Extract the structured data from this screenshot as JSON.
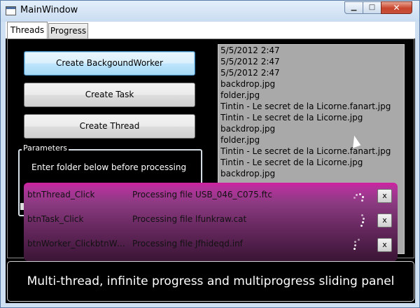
{
  "window": {
    "title": "MainWindow",
    "minimize_glyph": "▁",
    "maximize_glyph": "□",
    "close_glyph": "✕"
  },
  "tabs": [
    {
      "label": "Threads",
      "selected": true
    },
    {
      "label": "Progress",
      "selected": false
    }
  ],
  "buttons": {
    "worker": "Create BackgoundWorker",
    "task": "Create Task",
    "thread": "Create Thread"
  },
  "parameters": {
    "legend": "Parameters",
    "hint": "Enter folder below before processing"
  },
  "list_items": [
    "5/5/2012 2:47",
    "5/5/2012 2:47",
    "5/5/2012 2:47",
    "backdrop.jpg",
    "folder.jpg",
    "Tintin - Le secret de la Licorne.fanart.jpg",
    "Tintin - Le secret de la Licorne.jpg",
    "backdrop.jpg",
    "folder.jpg",
    "Tintin - Le secret de la Licorne.fanart.jpg",
    "Tintin - Le secret de la Licorne.jpg",
    "backdrop.jpg"
  ],
  "progress_rows": [
    {
      "name": "btnThread_Click",
      "message": "Processing file USB_046_C075.ftc",
      "close": "x"
    },
    {
      "name": "btnTask_Click",
      "message": "Processing file lfunkraw.cat",
      "close": "x"
    },
    {
      "name": "btnWorker_ClickbtnWorker_Click",
      "message": "Processing file Jfhideqd.inf",
      "close": "x"
    }
  ],
  "footer": {
    "caption": "Multi-thread, infinite progress and multiprogress sliding panel"
  },
  "colors": {
    "panel_top": "#d020a0",
    "panel_bottom": "#3a1535",
    "list_bg": "#a9a9a9",
    "focus_button": "#bee6fd"
  }
}
